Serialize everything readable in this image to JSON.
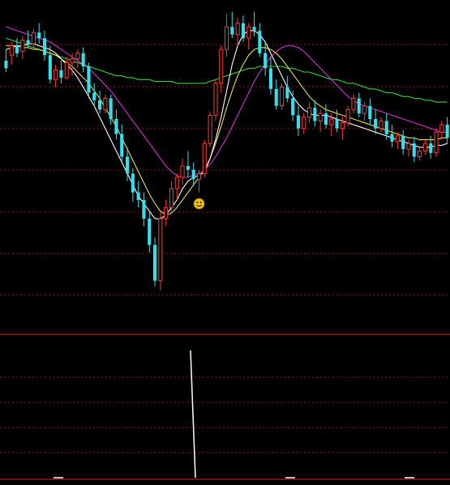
{
  "colors": {
    "background": "#000000",
    "grid": "#8b1a1a",
    "separator": "#b01c1c",
    "up_candle": "#ff3b30",
    "down_candle": "#33e0ee",
    "ma_white": "#ffffff",
    "ma_yellow": "#e8e04a",
    "ma_magenta": "#d22fd2",
    "ma_green": "#3ad23a",
    "signal_bar": "#ffffff",
    "marker": "#f0c400"
  },
  "marker_icon": "smiley-face-icon",
  "chart_data": [
    {
      "type": "candlestick",
      "title": "",
      "xlabel": "",
      "ylabel": "",
      "grid": true,
      "ylim": [
        0,
        100
      ],
      "candles": [
        {
          "o": 72,
          "h": 78,
          "l": 66,
          "c": 68
        },
        {
          "o": 75,
          "h": 82,
          "l": 70,
          "c": 80
        },
        {
          "o": 80,
          "h": 84,
          "l": 74,
          "c": 76
        },
        {
          "o": 77,
          "h": 85,
          "l": 73,
          "c": 83
        },
        {
          "o": 83,
          "h": 88,
          "l": 79,
          "c": 81
        },
        {
          "o": 81,
          "h": 89,
          "l": 78,
          "c": 87
        },
        {
          "o": 87,
          "h": 92,
          "l": 81,
          "c": 84
        },
        {
          "o": 84,
          "h": 88,
          "l": 72,
          "c": 75
        },
        {
          "o": 75,
          "h": 80,
          "l": 60,
          "c": 62
        },
        {
          "o": 62,
          "h": 70,
          "l": 58,
          "c": 67
        },
        {
          "o": 67,
          "h": 72,
          "l": 60,
          "c": 63
        },
        {
          "o": 63,
          "h": 74,
          "l": 62,
          "c": 71
        },
        {
          "o": 71,
          "h": 76,
          "l": 64,
          "c": 73
        },
        {
          "o": 73,
          "h": 78,
          "l": 68,
          "c": 76
        },
        {
          "o": 76,
          "h": 79,
          "l": 66,
          "c": 69
        },
        {
          "o": 69,
          "h": 71,
          "l": 52,
          "c": 55
        },
        {
          "o": 55,
          "h": 60,
          "l": 48,
          "c": 51
        },
        {
          "o": 51,
          "h": 56,
          "l": 44,
          "c": 46
        },
        {
          "o": 46,
          "h": 54,
          "l": 44,
          "c": 52
        },
        {
          "o": 52,
          "h": 54,
          "l": 38,
          "c": 41
        },
        {
          "o": 41,
          "h": 46,
          "l": 30,
          "c": 33
        },
        {
          "o": 33,
          "h": 38,
          "l": 18,
          "c": 21
        },
        {
          "o": 21,
          "h": 26,
          "l": 8,
          "c": 12
        },
        {
          "o": 12,
          "h": 15,
          "l": -3,
          "c": 2
        },
        {
          "o": 2,
          "h": 8,
          "l": -6,
          "c": -2
        },
        {
          "o": -2,
          "h": 2,
          "l": -16,
          "c": -12
        },
        {
          "o": -12,
          "h": -8,
          "l": -30,
          "c": -26
        },
        {
          "o": -26,
          "h": -22,
          "l": -48,
          "c": -45
        },
        {
          "o": -45,
          "h": -8,
          "l": -50,
          "c": -12
        },
        {
          "o": -12,
          "h": -2,
          "l": -16,
          "c": -6
        },
        {
          "o": -6,
          "h": 8,
          "l": -8,
          "c": 4
        },
        {
          "o": 4,
          "h": 12,
          "l": -2,
          "c": 10
        },
        {
          "o": 10,
          "h": 20,
          "l": 6,
          "c": 16
        },
        {
          "o": 16,
          "h": 24,
          "l": 10,
          "c": 14
        },
        {
          "o": 14,
          "h": 18,
          "l": 6,
          "c": 9
        },
        {
          "o": 9,
          "h": 14,
          "l": 2,
          "c": 12
        },
        {
          "o": 12,
          "h": 30,
          "l": 10,
          "c": 28
        },
        {
          "o": 28,
          "h": 45,
          "l": 26,
          "c": 43
        },
        {
          "o": 43,
          "h": 62,
          "l": 40,
          "c": 60
        },
        {
          "o": 60,
          "h": 80,
          "l": 55,
          "c": 78
        },
        {
          "o": 78,
          "h": 97,
          "l": 74,
          "c": 90
        },
        {
          "o": 90,
          "h": 98,
          "l": 84,
          "c": 86
        },
        {
          "o": 86,
          "h": 95,
          "l": 80,
          "c": 92
        },
        {
          "o": 92,
          "h": 96,
          "l": 82,
          "c": 84
        },
        {
          "o": 84,
          "h": 92,
          "l": 78,
          "c": 90
        },
        {
          "o": 90,
          "h": 98,
          "l": 85,
          "c": 88
        },
        {
          "o": 88,
          "h": 92,
          "l": 74,
          "c": 76
        },
        {
          "o": 76,
          "h": 82,
          "l": 64,
          "c": 68
        },
        {
          "o": 68,
          "h": 74,
          "l": 54,
          "c": 57
        },
        {
          "o": 57,
          "h": 62,
          "l": 46,
          "c": 48
        },
        {
          "o": 48,
          "h": 60,
          "l": 46,
          "c": 58
        },
        {
          "o": 58,
          "h": 64,
          "l": 50,
          "c": 52
        },
        {
          "o": 52,
          "h": 56,
          "l": 40,
          "c": 43
        },
        {
          "o": 43,
          "h": 48,
          "l": 32,
          "c": 36
        },
        {
          "o": 36,
          "h": 44,
          "l": 33,
          "c": 42
        },
        {
          "o": 42,
          "h": 50,
          "l": 39,
          "c": 47
        },
        {
          "o": 47,
          "h": 51,
          "l": 37,
          "c": 40
        },
        {
          "o": 40,
          "h": 46,
          "l": 34,
          "c": 44
        },
        {
          "o": 44,
          "h": 49,
          "l": 36,
          "c": 38
        },
        {
          "o": 38,
          "h": 44,
          "l": 32,
          "c": 41
        },
        {
          "o": 41,
          "h": 46,
          "l": 34,
          "c": 36
        },
        {
          "o": 36,
          "h": 42,
          "l": 30,
          "c": 39
        },
        {
          "o": 39,
          "h": 48,
          "l": 37,
          "c": 46
        },
        {
          "o": 46,
          "h": 54,
          "l": 44,
          "c": 52
        },
        {
          "o": 52,
          "h": 55,
          "l": 42,
          "c": 44
        },
        {
          "o": 44,
          "h": 50,
          "l": 40,
          "c": 48
        },
        {
          "o": 48,
          "h": 52,
          "l": 38,
          "c": 41
        },
        {
          "o": 41,
          "h": 46,
          "l": 33,
          "c": 36
        },
        {
          "o": 36,
          "h": 42,
          "l": 34,
          "c": 40
        },
        {
          "o": 40,
          "h": 44,
          "l": 30,
          "c": 33
        },
        {
          "o": 33,
          "h": 38,
          "l": 26,
          "c": 29
        },
        {
          "o": 29,
          "h": 34,
          "l": 25,
          "c": 32
        },
        {
          "o": 32,
          "h": 35,
          "l": 22,
          "c": 25
        },
        {
          "o": 25,
          "h": 30,
          "l": 21,
          "c": 28
        },
        {
          "o": 28,
          "h": 31,
          "l": 18,
          "c": 21
        },
        {
          "o": 21,
          "h": 26,
          "l": 19,
          "c": 24
        },
        {
          "o": 24,
          "h": 30,
          "l": 22,
          "c": 28
        },
        {
          "o": 28,
          "h": 32,
          "l": 20,
          "c": 23
        },
        {
          "o": 23,
          "h": 36,
          "l": 21,
          "c": 34
        },
        {
          "o": 34,
          "h": 40,
          "l": 30,
          "c": 38
        },
        {
          "o": 38,
          "h": 42,
          "l": 28,
          "c": 31
        }
      ],
      "series": [
        {
          "values": [
            84,
            83,
            82,
            81,
            80,
            79,
            78,
            77,
            76,
            75,
            74,
            73,
            72,
            71,
            70,
            69,
            68,
            67,
            66,
            65,
            64,
            64,
            63,
            63,
            62,
            62,
            62,
            61,
            61,
            61,
            61,
            60,
            60,
            60,
            60,
            60,
            60,
            61,
            62,
            63,
            64,
            65,
            66,
            67,
            68,
            68,
            69,
            69,
            69,
            69,
            69,
            68,
            68,
            67,
            66,
            66,
            65,
            64,
            63,
            62,
            62,
            61,
            60,
            60,
            59,
            58,
            57,
            57,
            56,
            55,
            55,
            54,
            53,
            53,
            52,
            52,
            51,
            51,
            50,
            50,
            50
          ]
        },
        {
          "values": [
            90,
            89,
            88,
            87,
            86,
            85,
            84,
            83,
            82,
            80,
            78,
            76,
            74,
            72,
            70,
            68,
            65,
            62,
            59,
            56,
            52,
            48,
            44,
            40,
            36,
            32,
            28,
            24,
            20,
            16,
            13,
            11,
            10,
            10,
            11,
            12,
            14,
            17,
            21,
            26,
            31,
            37,
            43,
            49,
            55,
            61,
            66,
            70,
            74,
            77,
            79,
            80,
            80,
            79,
            77,
            74,
            71,
            68,
            65,
            62,
            59,
            56,
            53,
            51,
            49,
            48,
            47,
            46,
            45,
            44,
            43,
            42,
            41,
            40,
            39,
            38,
            37,
            36,
            35,
            34,
            34
          ]
        },
        {
          "values": [
            80,
            80,
            80,
            79,
            79,
            78,
            78,
            77,
            76,
            75,
            73,
            71,
            69,
            66,
            63,
            60,
            56,
            52,
            47,
            42,
            37,
            31,
            25,
            19,
            13,
            7,
            1,
            -4,
            -8,
            -10,
            -9,
            -6,
            -2,
            2,
            6,
            10,
            14,
            20,
            28,
            37,
            47,
            56,
            64,
            70,
            75,
            78,
            79,
            79,
            78,
            76,
            73,
            69,
            65,
            61,
            57,
            53,
            50,
            48,
            46,
            45,
            44,
            43,
            42,
            41,
            40,
            39,
            38,
            37,
            36,
            35,
            34,
            33,
            32,
            31,
            31,
            30,
            30,
            30,
            30,
            31,
            31
          ]
        },
        {
          "values": [
            78,
            79,
            80,
            80,
            81,
            81,
            80,
            79,
            78,
            76,
            73,
            70,
            67,
            63,
            58,
            53,
            48,
            42,
            36,
            30,
            24,
            18,
            12,
            6,
            0,
            -4,
            -8,
            -12,
            -12,
            -10,
            -6,
            -2,
            4,
            8,
            10,
            11,
            13,
            20,
            30,
            42,
            56,
            70,
            80,
            86,
            88,
            88,
            86,
            82,
            76,
            70,
            64,
            58,
            53,
            49,
            46,
            44,
            43,
            43,
            43,
            42,
            41,
            40,
            39,
            38,
            37,
            36,
            35,
            34,
            33,
            32,
            31,
            30,
            29,
            28,
            27,
            26,
            26,
            26,
            27,
            27,
            28
          ]
        }
      ],
      "signals": [
        {
          "value": 0.04
        },
        {
          "value": 1.0
        },
        {
          "value": 0.04
        },
        {
          "value": 0.04
        }
      ]
    }
  ]
}
